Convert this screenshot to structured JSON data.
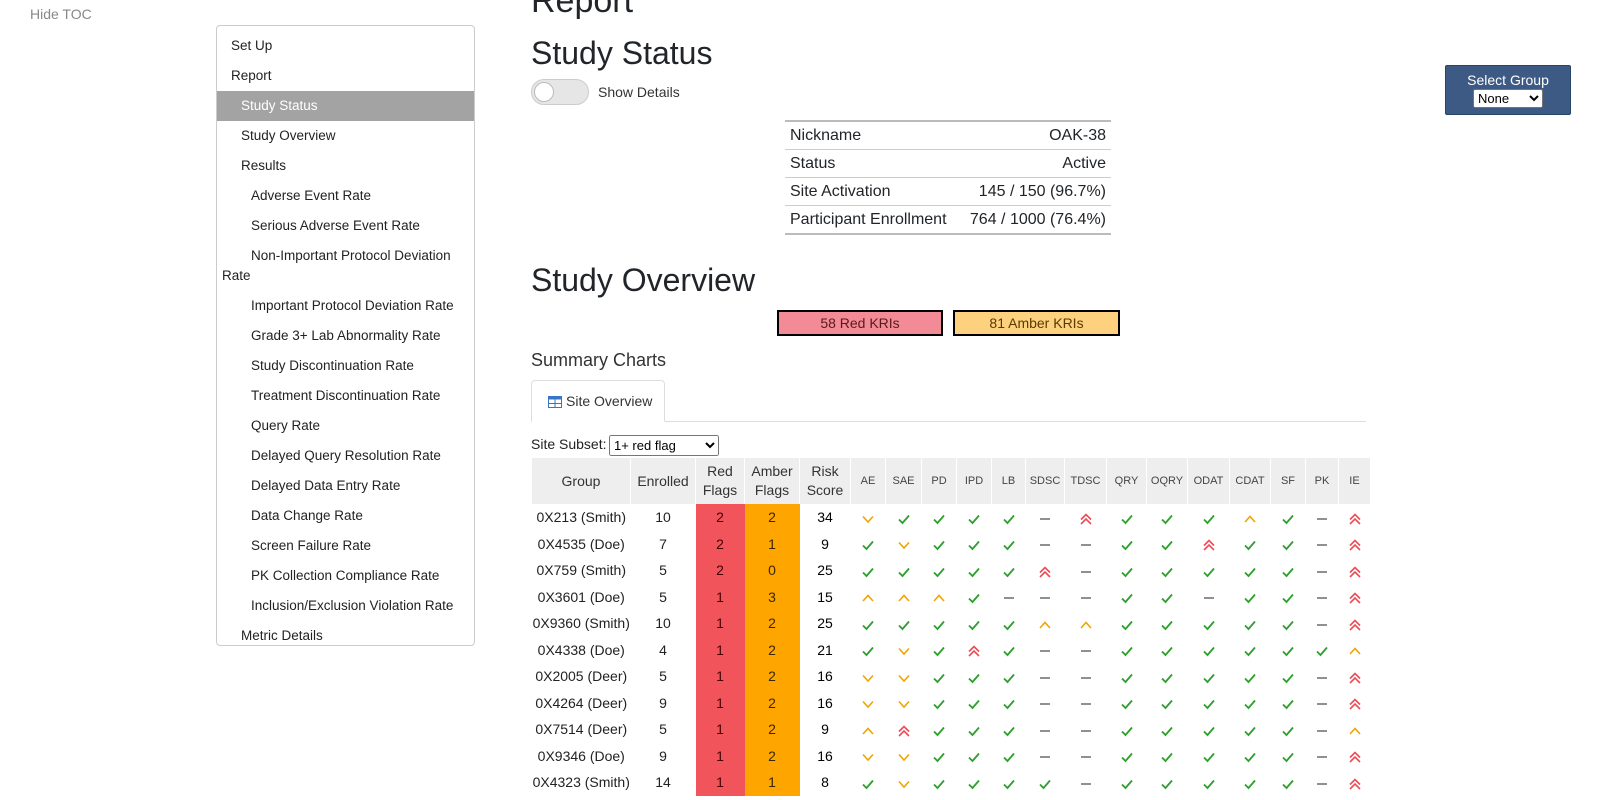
{
  "toc_toggle": "Hide TOC",
  "toc": [
    {
      "label": "Set Up",
      "level": 0
    },
    {
      "label": "Report",
      "level": 0
    },
    {
      "label": "Study Status",
      "level": 1,
      "active": true
    },
    {
      "label": "Study Overview",
      "level": 1
    },
    {
      "label": "Results",
      "level": 1
    },
    {
      "label": "Adverse Event Rate",
      "level": 2
    },
    {
      "label": "Serious Adverse Event Rate",
      "level": 2
    },
    {
      "label": "Non-Important Protocol Deviation Rate",
      "level": 2,
      "wrap": true
    },
    {
      "label": "Important Protocol Deviation Rate",
      "level": 2
    },
    {
      "label": "Grade 3+ Lab Abnormality Rate",
      "level": 2
    },
    {
      "label": "Study Discontinuation Rate",
      "level": 2
    },
    {
      "label": "Treatment Discontinuation Rate",
      "level": 2
    },
    {
      "label": "Query Rate",
      "level": 2
    },
    {
      "label": "Delayed Query Resolution Rate",
      "level": 2
    },
    {
      "label": "Delayed Data Entry Rate",
      "level": 2
    },
    {
      "label": "Data Change Rate",
      "level": 2
    },
    {
      "label": "Screen Failure Rate",
      "level": 2
    },
    {
      "label": "PK Collection Compliance Rate",
      "level": 2
    },
    {
      "label": "Inclusion/Exclusion Violation Rate",
      "level": 2
    },
    {
      "label": "Metric Details",
      "level": 1
    }
  ],
  "report_heading": "Report",
  "study_status": {
    "heading": "Study Status",
    "toggle_label": "Show Details",
    "rows": [
      {
        "label": "Nickname",
        "value": "OAK-38"
      },
      {
        "label": "Status",
        "value": "Active"
      },
      {
        "label": "Site Activation",
        "value": "145 / 150 (96.7%)"
      },
      {
        "label": "Participant Enrollment",
        "value": "764 / 1000 (76.4%)"
      }
    ]
  },
  "study_overview": {
    "heading": "Study Overview",
    "red_kris": "58 Red KRIs",
    "amber_kris": "81 Amber KRIs",
    "summary_title": "Summary Charts",
    "tab_label": "Site Overview",
    "subset_label": "Site Subset:",
    "subset_value": "1+ red flag",
    "subset_options": [
      "1+ red flag"
    ],
    "headers": {
      "group": "Group",
      "enrolled": "Enrolled",
      "red_flags": "Red Flags",
      "amber_flags": "Amber Flags",
      "risk_score": "Risk Score"
    },
    "metric_headers": [
      "AE",
      "SAE",
      "PD",
      "IPD",
      "LB",
      "SDSC",
      "TDSC",
      "QRY",
      "OQRY",
      "ODAT",
      "CDAT",
      "SF",
      "PK",
      "IE"
    ],
    "icon_legend": {
      "c": "check-icon",
      "d": "dash-icon",
      "au": "amber-up-icon",
      "ad": "amber-down-icon",
      "ru": "red-double-up-icon"
    },
    "rows": [
      {
        "group": "0X213 (Smith)",
        "enrolled": "10",
        "red": "2",
        "amber": "2",
        "risk": "34",
        "metrics": [
          "ad",
          "c",
          "c",
          "c",
          "c",
          "d",
          "ru",
          "c",
          "c",
          "c",
          "au",
          "c",
          "d",
          "ru"
        ]
      },
      {
        "group": "0X4535 (Doe)",
        "enrolled": "7",
        "red": "2",
        "amber": "1",
        "risk": "9",
        "metrics": [
          "c",
          "ad",
          "c",
          "c",
          "c",
          "d",
          "d",
          "c",
          "c",
          "ru",
          "c",
          "c",
          "d",
          "ru"
        ]
      },
      {
        "group": "0X759 (Smith)",
        "enrolled": "5",
        "red": "2",
        "amber": "0",
        "risk": "25",
        "metrics": [
          "c",
          "c",
          "c",
          "c",
          "c",
          "ru",
          "d",
          "c",
          "c",
          "c",
          "c",
          "c",
          "d",
          "ru"
        ]
      },
      {
        "group": "0X3601 (Doe)",
        "enrolled": "5",
        "red": "1",
        "amber": "3",
        "risk": "15",
        "metrics": [
          "au",
          "au",
          "au",
          "c",
          "d",
          "d",
          "d",
          "c",
          "c",
          "d",
          "c",
          "c",
          "d",
          "ru"
        ]
      },
      {
        "group": "0X9360 (Smith)",
        "enrolled": "10",
        "red": "1",
        "amber": "2",
        "risk": "25",
        "metrics": [
          "c",
          "c",
          "c",
          "c",
          "c",
          "au",
          "au",
          "c",
          "c",
          "c",
          "c",
          "c",
          "d",
          "ru"
        ]
      },
      {
        "group": "0X4338 (Doe)",
        "enrolled": "4",
        "red": "1",
        "amber": "2",
        "risk": "21",
        "metrics": [
          "c",
          "ad",
          "c",
          "ru",
          "c",
          "d",
          "d",
          "c",
          "c",
          "c",
          "c",
          "c",
          "c",
          "au"
        ]
      },
      {
        "group": "0X2005 (Deer)",
        "enrolled": "5",
        "red": "1",
        "amber": "2",
        "risk": "16",
        "metrics": [
          "ad",
          "ad",
          "c",
          "c",
          "c",
          "d",
          "d",
          "c",
          "c",
          "c",
          "c",
          "c",
          "d",
          "ru"
        ]
      },
      {
        "group": "0X4264 (Deer)",
        "enrolled": "9",
        "red": "1",
        "amber": "2",
        "risk": "16",
        "metrics": [
          "ad",
          "ad",
          "c",
          "c",
          "c",
          "d",
          "d",
          "c",
          "c",
          "c",
          "c",
          "c",
          "d",
          "ru"
        ]
      },
      {
        "group": "0X7514 (Deer)",
        "enrolled": "5",
        "red": "1",
        "amber": "2",
        "risk": "9",
        "metrics": [
          "au",
          "ru",
          "c",
          "c",
          "c",
          "d",
          "d",
          "c",
          "c",
          "c",
          "c",
          "c",
          "d",
          "au"
        ]
      },
      {
        "group": "0X9346 (Doe)",
        "enrolled": "9",
        "red": "1",
        "amber": "2",
        "risk": "16",
        "metrics": [
          "ad",
          "ad",
          "c",
          "c",
          "c",
          "d",
          "d",
          "c",
          "c",
          "c",
          "c",
          "c",
          "d",
          "ru"
        ]
      },
      {
        "group": "0X4323 (Smith)",
        "enrolled": "14",
        "red": "1",
        "amber": "1",
        "risk": "8",
        "metrics": [
          "c",
          "ad",
          "c",
          "c",
          "c",
          "c",
          "d",
          "c",
          "c",
          "c",
          "c",
          "c",
          "d",
          "ru"
        ]
      }
    ]
  },
  "select_group": {
    "title": "Select Group",
    "value": "None",
    "options": [
      "None"
    ]
  },
  "colors": {
    "red_flag": "#f2545b",
    "amber_flag": "#ffa500",
    "check": "#2ca02c",
    "amber_icon": "#f0a500",
    "red_icon": "#ee4b55",
    "toc_active": "#a3a3a3",
    "group_box": "#3d5a85"
  }
}
